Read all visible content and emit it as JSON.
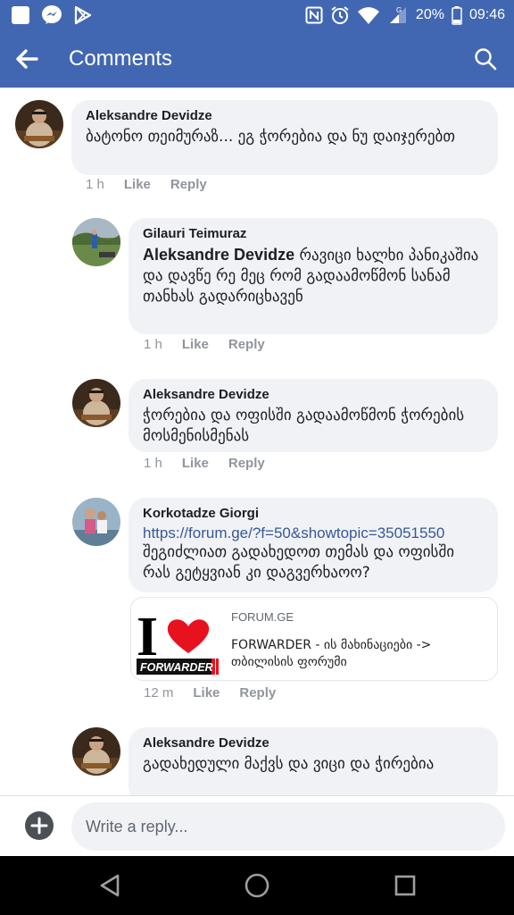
{
  "status_bar": {
    "battery": "20%",
    "time": "09:46",
    "icons": [
      "app-square-icon",
      "messenger-icon",
      "play-store-icon",
      "nfc-icon",
      "alarm-icon",
      "wifi-icon",
      "signal-icon",
      "battery-icon"
    ]
  },
  "app_bar": {
    "title": "Comments",
    "back_icon": "arrow-left-icon",
    "search_icon": "search-icon"
  },
  "comments": [
    {
      "author": "Aleksandre Devidze",
      "text": "ბატონო თეიმურაზ... ეგ ჭორებია და ნუ დაიჯერებთ",
      "time": "1 h",
      "like": "Like",
      "reply": "Reply"
    },
    {
      "author": "Gilauri Teimuraz",
      "mention": "Aleksandre Devidze",
      "text": "რავიცი ხალხი პანიკაშია და დავწე რე მეც რომ გადაამოწმონ სანამ თანხას გადარიცხავენ",
      "time": "1 h",
      "like": "Like",
      "reply": "Reply"
    },
    {
      "author": "Aleksandre Devidze",
      "text": "ჭორებია და ოფისში გადაამოწმონ ჭორების მოსმენისმენას",
      "time": "1 h",
      "like": "Like",
      "reply": "Reply"
    },
    {
      "author": "Korkotadze Giorgi",
      "link": "https://forum.ge/?f=50&showtopic=35051550",
      "text": "შეგიძლიათ გადახედოთ თემას და ოფისში რას გეტყვიან კი დაგვერხაოო?",
      "preview": {
        "domain": "FORUM.GE",
        "title": "FORWARDER - ის მახინაციები -> თბილისის ფორუმი",
        "thumb_text": "FORWARDER",
        "thumb_letter": "I"
      },
      "time": "12 m",
      "like": "Like",
      "reply": "Reply"
    },
    {
      "author": "Aleksandre Devidze",
      "text": "გადახედული მაქვს და ვიცი და ჭირებია"
    }
  ],
  "reply_bar": {
    "placeholder": "Write a reply..."
  },
  "colors": {
    "brand": "#4267b2",
    "bubble": "#f0f2f5",
    "link": "#385898",
    "heart": "#e8121f"
  }
}
